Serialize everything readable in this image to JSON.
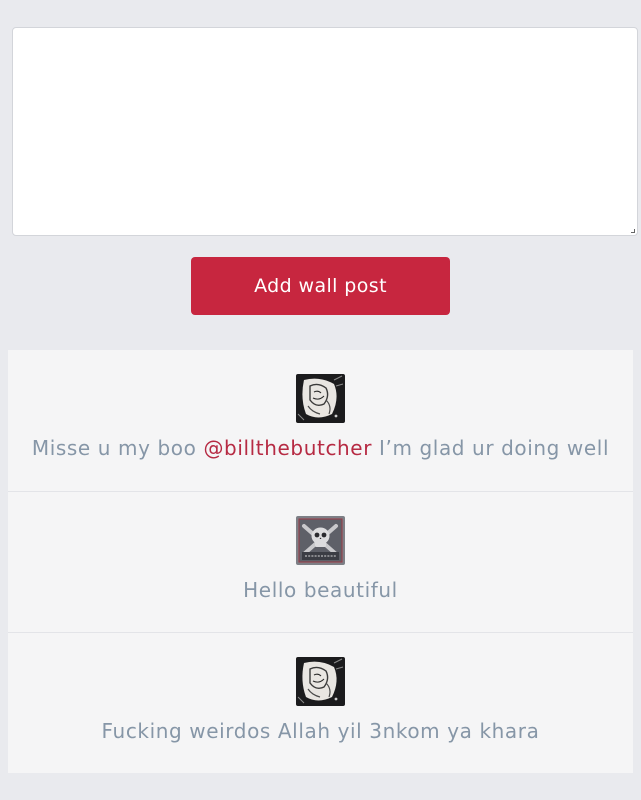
{
  "composer": {
    "value": "",
    "placeholder": ""
  },
  "actions": {
    "add_wall_post_label": "Add wall post"
  },
  "colors": {
    "accent": "#c7263f",
    "mention": "#b62a43",
    "post_text": "#8696a7",
    "background": "#e9eaee",
    "card": "#f5f5f6"
  },
  "posts": [
    {
      "avatar": "sketch-portrait-avatar",
      "text_before": "Misse u my boo ",
      "mention": "@billthebutcher",
      "text_after": " I’m glad ur doing well"
    },
    {
      "avatar": "skull-crossbones-avatar",
      "text": "Hello beautiful"
    },
    {
      "avatar": "sketch-portrait-avatar",
      "text": "Fucking weirdos Allah yil 3nkom ya khara"
    }
  ]
}
